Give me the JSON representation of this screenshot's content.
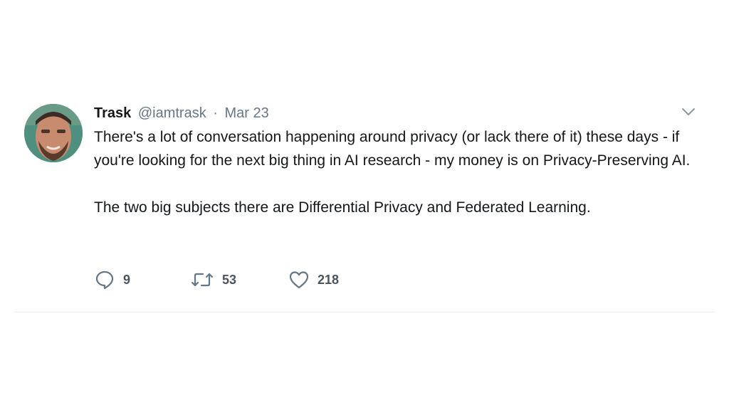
{
  "tweet": {
    "author": {
      "name": "Trask",
      "handle": "@iamtrask"
    },
    "separator": "·",
    "date": "Mar 23",
    "text": {
      "paragraph_1": "There's a lot of conversation happening around privacy (or lack there of it) these days - if you're looking for the next big thing in AI research - my money is on Privacy-Preserving AI.",
      "paragraph_2": "The two big subjects there are Differential Privacy and Federated Learning."
    },
    "actions": {
      "replies": "9",
      "retweets": "53",
      "likes": "218"
    },
    "icons": {
      "reply": "reply-icon",
      "retweet": "retweet-icon",
      "like": "heart-icon",
      "menu": "chevron-down-icon"
    },
    "colors": {
      "text": "#14171a",
      "secondary": "#657786",
      "icon": "#657786"
    }
  }
}
